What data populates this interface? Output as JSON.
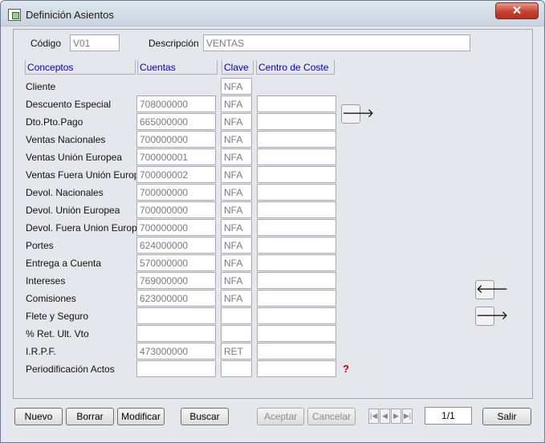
{
  "window": {
    "title": "Definición Asientos",
    "close_glyph": "✕"
  },
  "header": {
    "codigo_label": "Código",
    "codigo_value": "V01",
    "descripcion_label": "Descripción",
    "descripcion_value": "VENTAS"
  },
  "columns": [
    "Conceptos",
    "Cuentas",
    "Clave",
    "Centro de Coste"
  ],
  "rows": [
    {
      "concepto": "Cliente",
      "cuenta": null,
      "clave": "NFA",
      "centro": null
    },
    {
      "concepto": "Descuento Especial",
      "cuenta": "708000000",
      "clave": "NFA",
      "centro": ""
    },
    {
      "concepto": "Dto.Pto.Pago",
      "cuenta": "665000000",
      "clave": "NFA",
      "centro": ""
    },
    {
      "concepto": "Ventas Nacionales",
      "cuenta": "700000000",
      "clave": "NFA",
      "centro": ""
    },
    {
      "concepto": "Ventas Unión Europea",
      "cuenta": "700000001",
      "clave": "NFA",
      "centro": ""
    },
    {
      "concepto": "Ventas Fuera Unión Europea",
      "cuenta": "700000002",
      "clave": "NFA",
      "centro": ""
    },
    {
      "concepto": "Devol. Nacionales",
      "cuenta": "700000000",
      "clave": "NFA",
      "centro": ""
    },
    {
      "concepto": "Devol. Unión Europea",
      "cuenta": "700000000",
      "clave": "NFA",
      "centro": ""
    },
    {
      "concepto": "Devol. Fuera Union Europea",
      "cuenta": "700000000",
      "clave": "NFA",
      "centro": ""
    },
    {
      "concepto": "Portes",
      "cuenta": "624000000",
      "clave": "NFA",
      "centro": ""
    },
    {
      "concepto": "Entrega a Cuenta",
      "cuenta": "570000000",
      "clave": "NFA",
      "centro": ""
    },
    {
      "concepto": "Intereses",
      "cuenta": "769000000",
      "clave": "NFA",
      "centro": ""
    },
    {
      "concepto": "Comisiones",
      "cuenta": "623000000",
      "clave": "NFA",
      "centro": ""
    },
    {
      "concepto": "Flete y Seguro",
      "cuenta": "",
      "clave": "",
      "centro": ""
    },
    {
      "concepto": "% Ret. Ult. Vto",
      "cuenta": "",
      "clave": "",
      "centro": ""
    },
    {
      "concepto": "I.R.P.F.",
      "cuenta": "473000000",
      "clave": "RET",
      "centro": ""
    },
    {
      "concepto": "Periodificación Actos",
      "cuenta": "",
      "clave": "",
      "centro": ""
    }
  ],
  "side_buttons": {
    "right_arrow": "🡒",
    "left_arrow": "🡐"
  },
  "help_icon_glyph": "?",
  "footer": {
    "nuevo": "Nuevo",
    "borrar": "Borrar",
    "modificar": "Modificar",
    "buscar": "Buscar",
    "aceptar": "Aceptar",
    "cancelar": "Cancelar",
    "page": "1/1",
    "salir": "Salir"
  }
}
